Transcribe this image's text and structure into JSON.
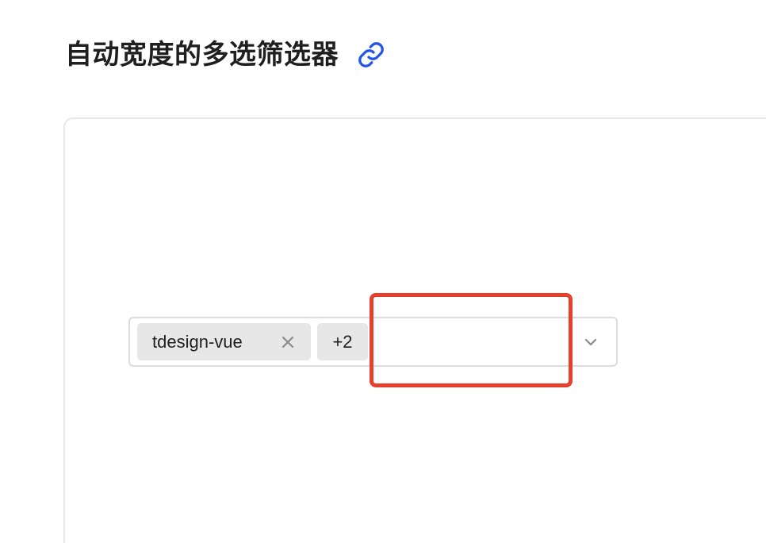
{
  "header": {
    "title": "自动宽度的多选筛选器",
    "link_icon": "link-icon"
  },
  "select": {
    "tags": [
      {
        "label": "tdesign-vue",
        "close_icon": "close-icon"
      }
    ],
    "more_tag": "+2",
    "input_value": "",
    "input_placeholder": "",
    "chevron_icon": "chevron-down-icon"
  },
  "colors": {
    "title_text": "#1f1f1f",
    "link_accent": "#2355e8",
    "tag_bg": "#e7e7e7",
    "border": "#dcdcdc",
    "highlight": "#e6402e"
  }
}
